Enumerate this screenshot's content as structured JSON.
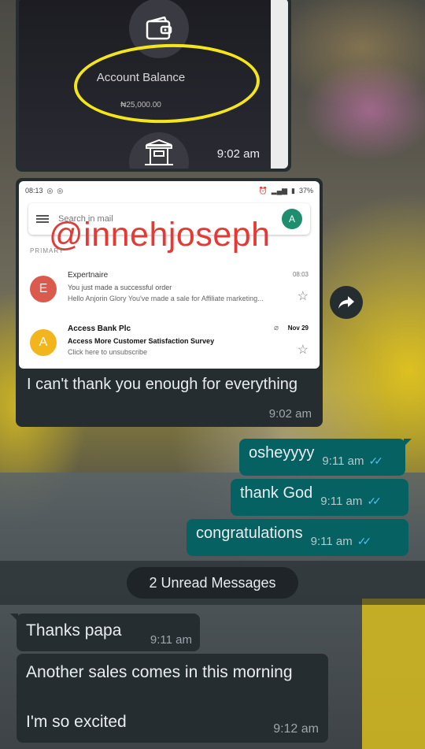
{
  "top_image": {
    "account_title": "Account Balance",
    "account_amount": "₦25,000.00",
    "time": "9:02 am"
  },
  "email_screenshot": {
    "status_time": "08:13",
    "battery": "37%",
    "search_placeholder": "Search in mail",
    "account_avatar": "A",
    "watermark": "@innehjoseph",
    "section_label": "PRIMARY",
    "emails": [
      {
        "avatar": "E",
        "avatar_color": "#db5a4e",
        "sender": "Expertnaire",
        "subject": "You just made a successful order",
        "snippet": "Hello Anjorin Glory You've made a sale for Affiliate marketing...",
        "time": "08:03"
      },
      {
        "avatar": "A",
        "avatar_color": "#f2b51c",
        "sender": "Access Bank Plc",
        "subject": "Access More Customer Satisfaction Survey",
        "snippet": "Click here to unsubscribe",
        "time": "Nov 29"
      }
    ]
  },
  "messages": {
    "caption": "I can't thank you enough for everything",
    "caption_time": "9:02 am",
    "outgoing": [
      {
        "text": "osheyyyy",
        "time": "9:11 am"
      },
      {
        "text": "thank God",
        "time": "9:11 am"
      },
      {
        "text": "congratulations",
        "time": "9:11 am"
      }
    ],
    "unread_label": "2 Unread Messages",
    "incoming": [
      {
        "text": "Thanks papa",
        "time": "9:11 am"
      },
      {
        "line1": "Another sales comes in this morning",
        "line2": "I'm so excited",
        "time": "9:12 am"
      }
    ]
  },
  "colors": {
    "incoming_bubble": "#262d31",
    "outgoing_bubble": "#056162",
    "read_ticks": "#53bdeb",
    "highlight": "#f4e61a",
    "watermark": "#e53935"
  }
}
